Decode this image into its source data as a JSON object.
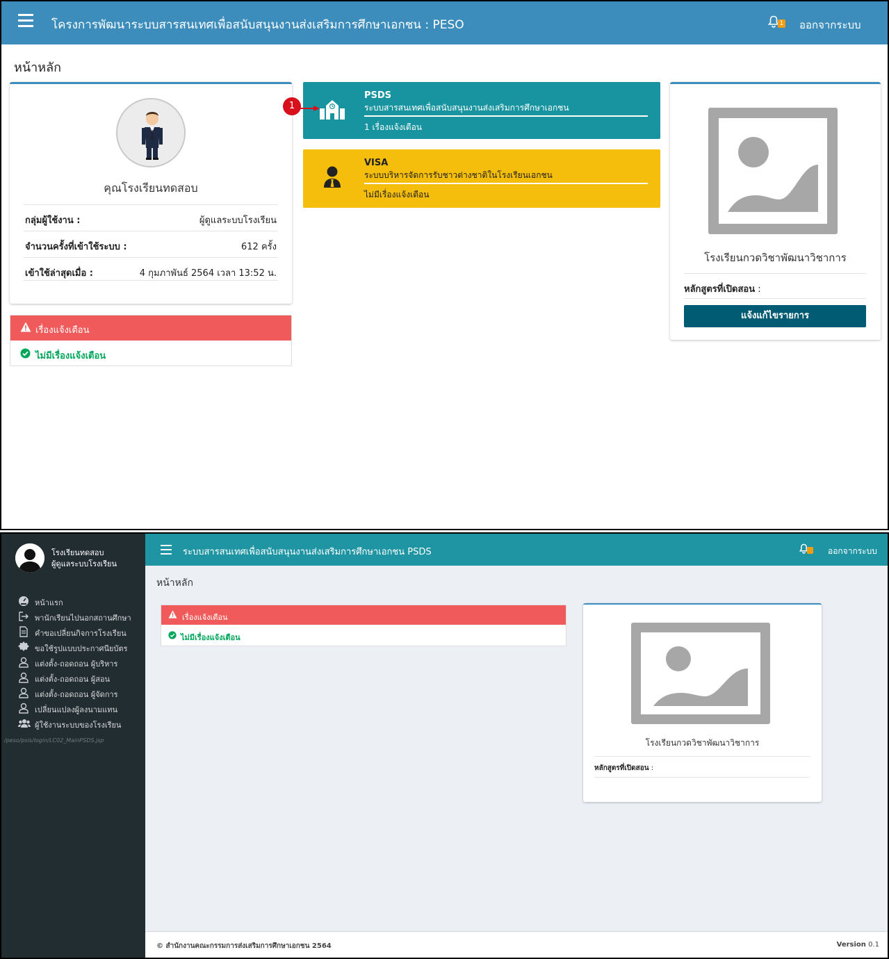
{
  "top": {
    "nav_title": "โครงการพัฒนาระบบสารสนเทศเพื่อสนับสนุนงานส่งเสริมการศึกษาเอกชน : PESO",
    "bell_badge": "1",
    "logout": "ออกจากระบบ",
    "page_title": "หน้าหลัก",
    "profile": {
      "name": "คุณโรงเรียนทดสอบ",
      "rows": [
        {
          "label": "กลุ่มผู้ใช้งาน :",
          "value": "ผู้ดูแลระบบโรงเรียน"
        },
        {
          "label": "จำนวนครั้งที่เข้าใช้ระบบ :",
          "value": "612  ครั้ง"
        },
        {
          "label": "เข้าใช้ล่าสุดเมื่อ :",
          "value": "4 กุมภาพันธ์ 2564 เวลา 13:52 น."
        }
      ]
    },
    "alert": {
      "title": "เรื่องแจ้งเตือน",
      "body": "ไม่มีเรื่องแจ้งเตือน"
    },
    "marker": "1",
    "tiles": [
      {
        "title": "PSDS",
        "subtitle": "ระบบสารสนเทศเพื่อสนับสนุนงานส่งเสริมการศึกษาเอกชน",
        "note": "1 เรื่องแจ้งเตือน",
        "color": "#17949f",
        "icon": "school-icon"
      },
      {
        "title": "VISA",
        "subtitle": "ระบบบริหารจัดการรับชาวต่างชาติในโรงเรียนเอกชน",
        "note": "ไม่มีเรื่องแจ้งเตือน",
        "color": "#f5bd0c",
        "icon": "user-tie-icon"
      }
    ],
    "school": {
      "name": "โรงเรียนกวดวิชาพัฒนาวิชาการ",
      "course_label": "หลักสูตรที่เปิดสอน",
      "course_colon": " :",
      "edit_button": "แจ้งแก้ไขรายการ"
    }
  },
  "bottom": {
    "user": {
      "name": "โรงเรียนทดสอบ",
      "role": "ผู้ดูแลระบบโรงเรียน"
    },
    "menu": [
      {
        "label": "หน้าแรก",
        "icon": "dashboard-icon"
      },
      {
        "label": "พานักเรียนไปนอกสถานศึกษา",
        "icon": "sign-out-icon"
      },
      {
        "label": "คำขอเปลี่ยนกิจการโรงเรียน",
        "icon": "document-icon"
      },
      {
        "label": "ขอใช้รูปแบบประกาศนียบัตร",
        "icon": "certificate-icon"
      },
      {
        "label": "แต่งตั้ง-ถอดถอน ผู้บริหาร",
        "icon": "user-icon"
      },
      {
        "label": "แต่งตั้ง-ถอดถอน ผู้สอน",
        "icon": "user-icon"
      },
      {
        "label": "แต่งตั้ง-ถอดถอน ผู้จัดการ",
        "icon": "user-icon"
      },
      {
        "label": "เปลี่ยนแปลงผู้ลงนามแทน",
        "icon": "user-icon"
      },
      {
        "label": "ผู้ใช้งานระบบของโรงเรียน",
        "icon": "users-icon"
      }
    ],
    "path": "/peso/psis/login/LC02_MainPSDS.jsp",
    "header_title": "ระบบสารสนเทศเพื่อสนับสนุนงานส่งเสริมการศึกษาเอกชน PSDS",
    "logout": "ออกจากระบบ",
    "page_title": "หน้าหลัก",
    "alert": {
      "title": "เรื่องแจ้งเตือน",
      "body": "ไม่มีเรื่องแจ้งเตือน"
    },
    "school": {
      "name": "โรงเรียนกวดวิชาพัฒนาวิชาการ",
      "course_label": "หลักสูตรที่เปิดสอน",
      "course_colon": " :"
    },
    "footer": {
      "copyright": "© สำนักงานคณะกรรมการส่งเสริมการศึกษาเอกชน 2564",
      "version_label": "Version",
      "version": "0.1"
    }
  },
  "colors": {
    "navbar": "#3c8dbc",
    "psds_header": "#1f95a4",
    "sidebar": "#222d32",
    "alert_red": "#f05a5a",
    "success_green": "#00a65a",
    "edit_button": "#005b73"
  }
}
